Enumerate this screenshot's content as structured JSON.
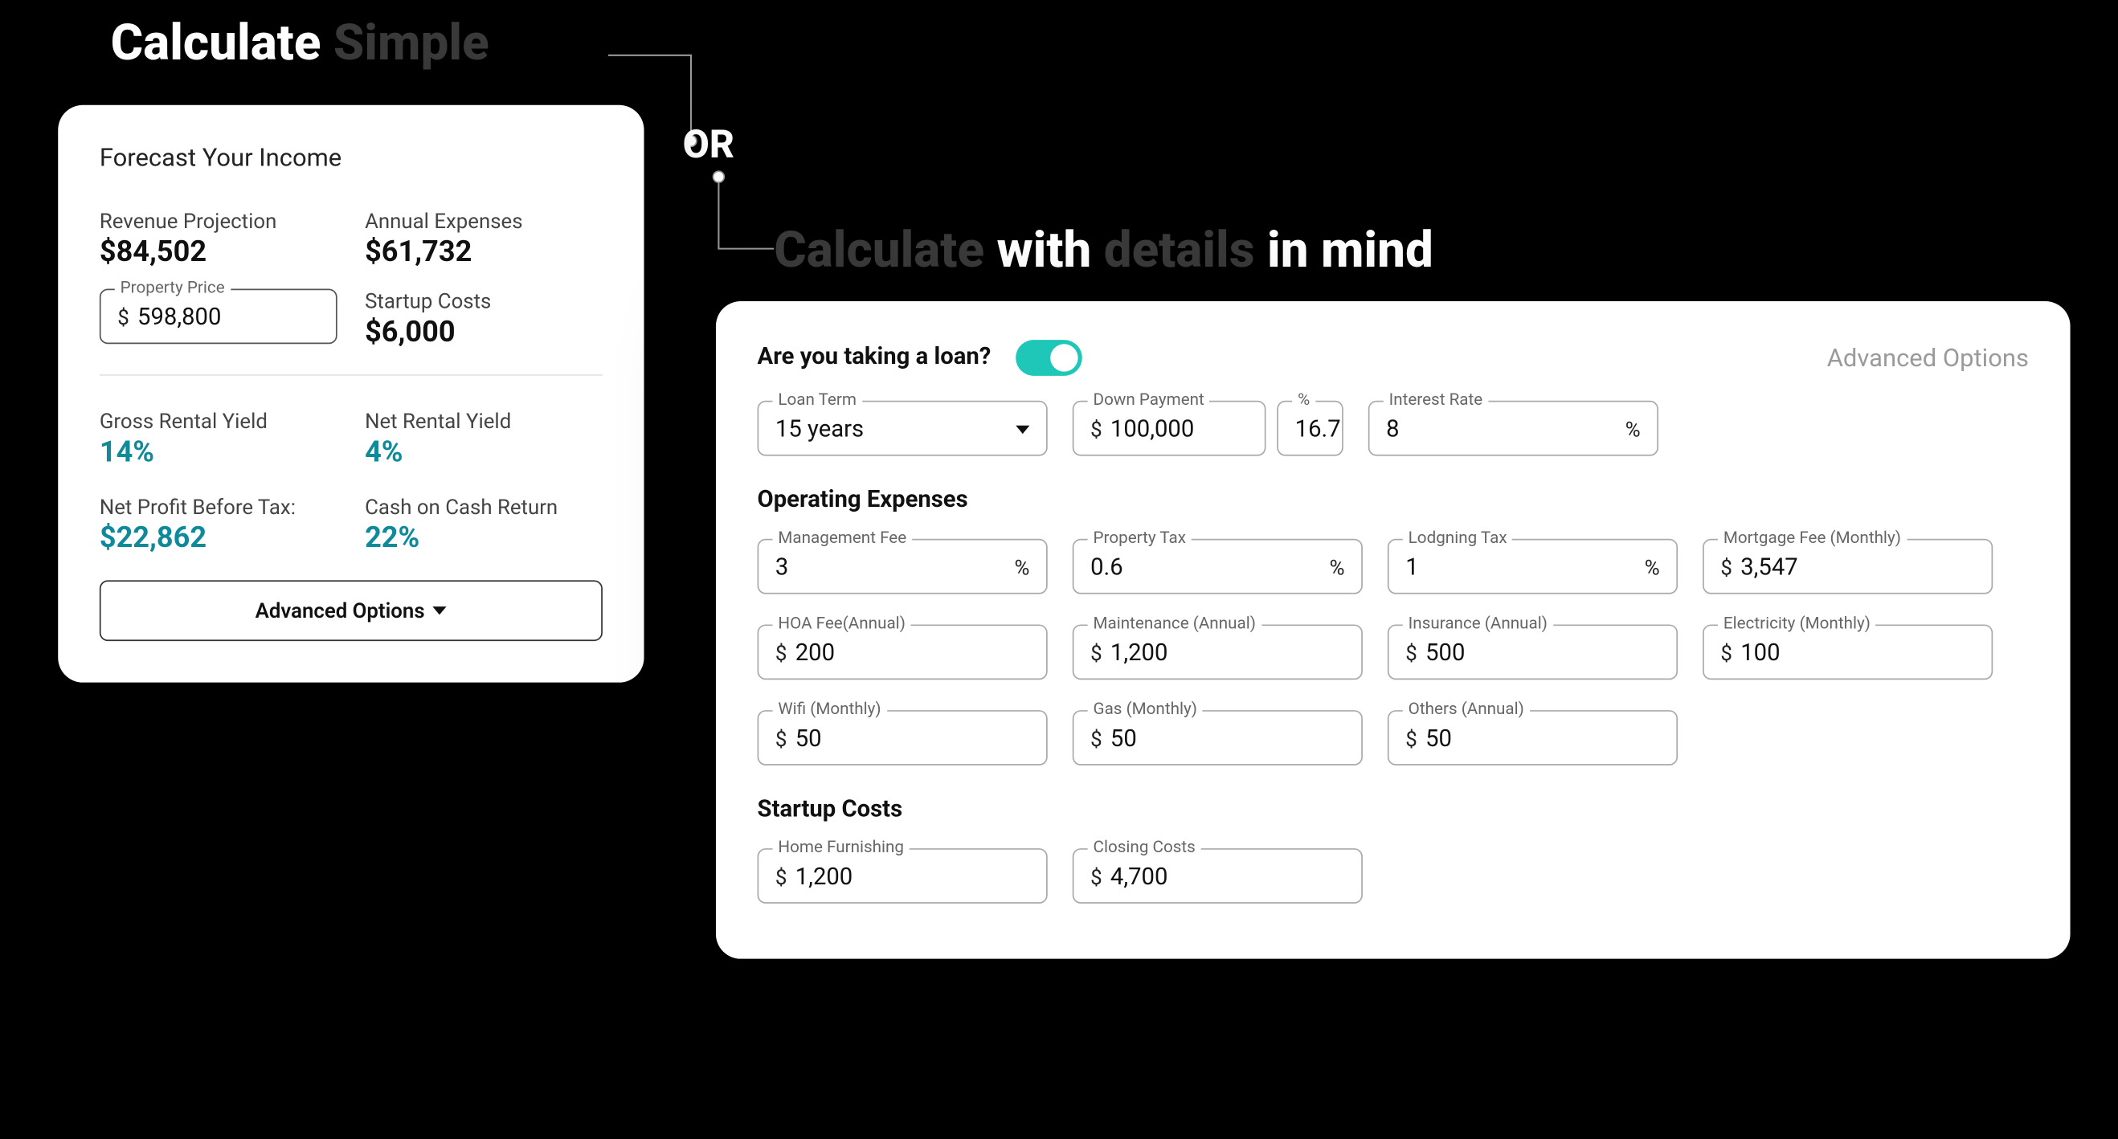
{
  "headings": {
    "simple_prefix": "Calculate ",
    "simple_dim": "Simple",
    "or": "OR",
    "details_dim1": "Calculate ",
    "details_mid": "with ",
    "details_dim2": "details ",
    "details_end": "in mind"
  },
  "simple": {
    "title": "Forecast Your Income",
    "revenue_label": "Revenue Projection",
    "revenue_value": "$84,502",
    "expenses_label": "Annual Expenses",
    "expenses_value": "$61,732",
    "price_label": "Property Price",
    "price_prefix": "$",
    "price_value": "598,800",
    "startup_label": "Startup Costs",
    "startup_value": "$6,000",
    "gross_yield_label": "Gross Rental Yield",
    "gross_yield_value": "14%",
    "net_yield_label": "Net Rental Yield",
    "net_yield_value": "4%",
    "net_profit_label": "Net Profit Before Tax:",
    "net_profit_value": "$22,862",
    "cash_return_label": "Cash on Cash Return",
    "cash_return_value": "22%",
    "adv_btn": "Advanced Options"
  },
  "advanced": {
    "loan_question": "Are you taking a loan?",
    "header_label": "Advanced Options",
    "loan": {
      "term_label": "Loan Term",
      "term_value": "15 years",
      "down_label": "Down Payment",
      "down_value": "100,000",
      "pct_label": "%",
      "pct_value": "16.7",
      "rate_label": "Interest Rate",
      "rate_value": "8"
    },
    "operating_h": "Operating Expenses",
    "op": {
      "mgmt_label": "Management Fee",
      "mgmt_value": "3",
      "ptax_label": "Property Tax",
      "ptax_value": "0.6",
      "ltax_label": "Lodgning Tax",
      "ltax_value": "1",
      "mortgage_label": "Mortgage Fee (Monthly)",
      "mortgage_value": "3,547",
      "hoa_label": "HOA Fee(Annual)",
      "hoa_value": "200",
      "maint_label": "Maintenance (Annual)",
      "maint_value": "1,200",
      "ins_label": "Insurance (Annual)",
      "ins_value": "500",
      "elec_label": "Electricity (Monthly)",
      "elec_value": "100",
      "wifi_label": "Wifi (Monthly)",
      "wifi_value": "50",
      "gas_label": "Gas (Monthly)",
      "gas_value": "50",
      "others_label": "Others (Annual)",
      "others_value": "50"
    },
    "startup_h": "Startup Costs",
    "startup": {
      "furnish_label": "Home Furnishing",
      "furnish_value": "1,200",
      "closing_label": "Closing Costs",
      "closing_value": "4,700"
    },
    "dollar": "$",
    "pct": "%"
  }
}
